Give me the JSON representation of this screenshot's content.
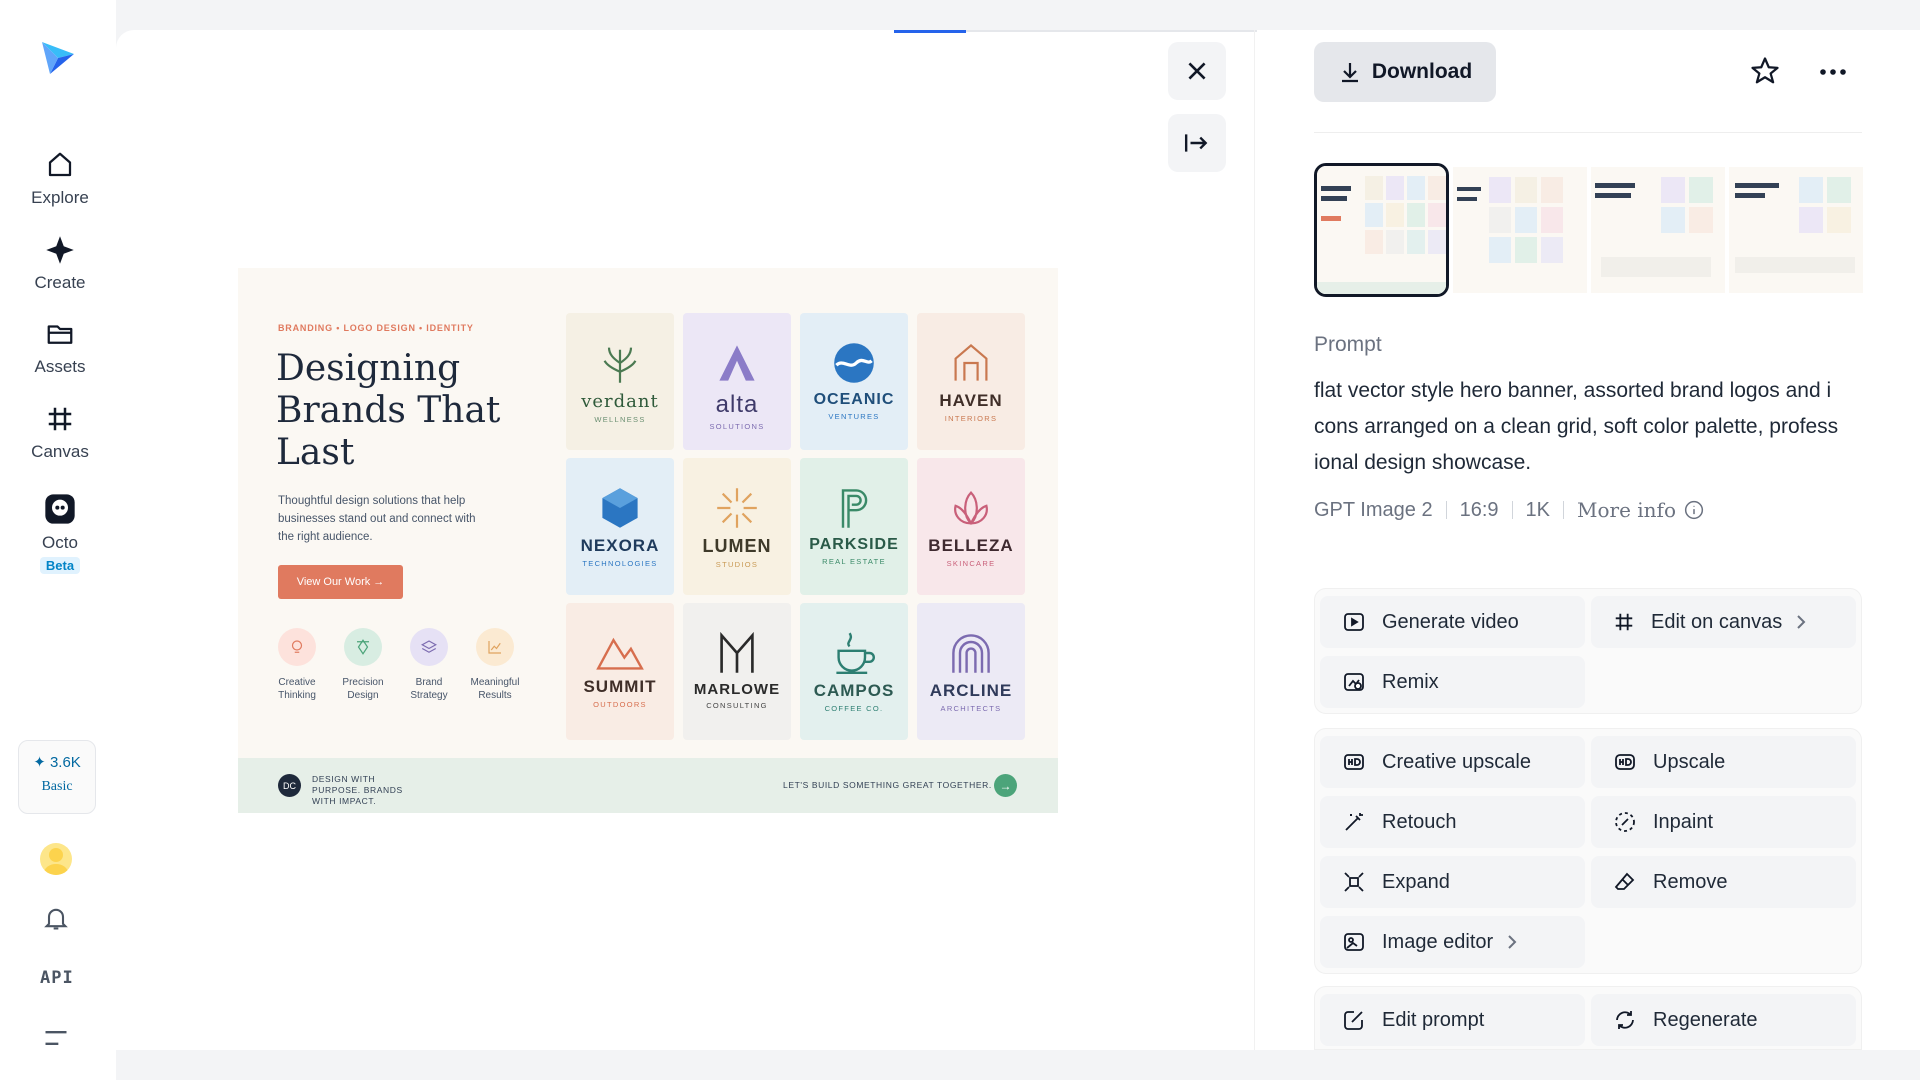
{
  "nav": {
    "items": [
      {
        "label": "Explore"
      },
      {
        "label": "Create"
      },
      {
        "label": "Assets"
      },
      {
        "label": "Canvas"
      },
      {
        "label": "Octo",
        "badge": "Beta"
      }
    ],
    "credits": {
      "amount": "✦ 3.6K",
      "plan": "Basic"
    },
    "api_label": "API"
  },
  "viewer": {
    "close_icon": "close-icon",
    "collapse_icon": "collapse-panel-icon"
  },
  "banner": {
    "eyebrow": "BRANDING • LOGO DESIGN • IDENTITY",
    "headline": "Designing Brands That Last",
    "description": "Thoughtful design solutions that help businesses stand out and connect with the right audience.",
    "cta": "View Our Work →",
    "features": [
      {
        "label": "Creative Thinking"
      },
      {
        "label": "Precision Design"
      },
      {
        "label": "Brand Strategy"
      },
      {
        "label": "Meaningful Results"
      }
    ],
    "tiles": [
      {
        "name": "verdant",
        "sub": "WELLNESS"
      },
      {
        "name": "alta",
        "sub": "SOLUTIONS"
      },
      {
        "name": "OCEANIC",
        "sub": "VENTURES"
      },
      {
        "name": "HAVEN",
        "sub": "INTERIORS"
      },
      {
        "name": "NEXORA",
        "sub": "TECHNOLOGIES"
      },
      {
        "name": "LUMEN",
        "sub": "STUDIOS"
      },
      {
        "name": "PARKSIDE",
        "sub": "REAL ESTATE"
      },
      {
        "name": "BELLEZA",
        "sub": "SKINCARE"
      },
      {
        "name": "SUMMIT",
        "sub": "OUTDOORS"
      },
      {
        "name": "MARLOWE",
        "sub": "CONSULTING"
      },
      {
        "name": "CAMPOS",
        "sub": "COFFEE CO."
      },
      {
        "name": "ARCLINE",
        "sub": "ARCHITECTS"
      }
    ],
    "footer_initials": "DC",
    "footer_left": "DESIGN WITH PURPOSE. BRANDS WITH IMPACT.",
    "footer_right": "LET'S BUILD SOMETHING GREAT TOGETHER.",
    "footer_arrow": "→"
  },
  "panel": {
    "download_label": "Download",
    "prompt_label": "Prompt",
    "prompt_text": "flat vector style hero banner, assorted brand logos and i cons arranged on a clean grid, soft color palette, profess ional design showcase.",
    "meta": {
      "model": "GPT Image 2",
      "ratio": "16:9",
      "resolution": "1K",
      "more_info": "More info"
    },
    "actions": {
      "generate_video": "Generate video",
      "edit_on_canvas": "Edit on canvas",
      "remix": "Remix",
      "creative_upscale": "Creative upscale",
      "upscale": "Upscale",
      "retouch": "Retouch",
      "inpaint": "Inpaint",
      "expand": "Expand",
      "remove": "Remove",
      "image_editor": "Image editor",
      "edit_prompt": "Edit prompt",
      "regenerate": "Regenerate"
    }
  },
  "colors": {
    "accent": "#e07a5f",
    "brand_blue": "#2563eb",
    "beta_text": "#0284c7"
  }
}
